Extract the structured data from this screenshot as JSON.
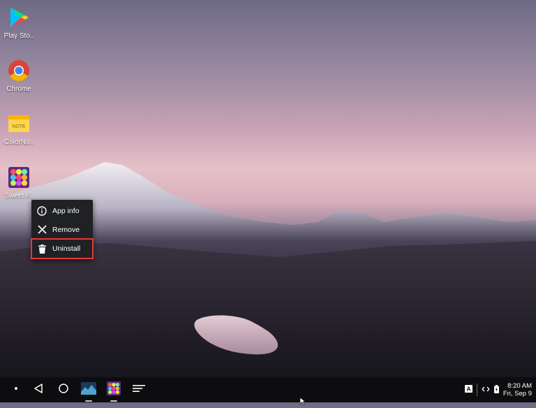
{
  "desktop": {
    "icons": [
      {
        "label": "Play Sto..",
        "icon": "play-store-icon"
      },
      {
        "label": "Chrome",
        "icon": "chrome-icon"
      },
      {
        "label": "ColorNo..",
        "icon": "colornote-icon"
      },
      {
        "label": "Sweet F..",
        "icon": "sweet-fruit-icon"
      }
    ]
  },
  "context_menu": {
    "items": [
      {
        "label": "App info",
        "icon": "info-icon"
      },
      {
        "label": "Remove",
        "icon": "close-icon"
      },
      {
        "label": "Uninstall",
        "icon": "trash-icon",
        "highlighted": true
      }
    ],
    "highlight_color": "#e53935"
  },
  "taskbar": {
    "launcher": "launcher-icon",
    "back": "back-icon",
    "home": "home-icon",
    "recents": "recents-icon",
    "tray": {
      "time": "8:20 AM",
      "date": "Fri, Sep 9"
    }
  }
}
